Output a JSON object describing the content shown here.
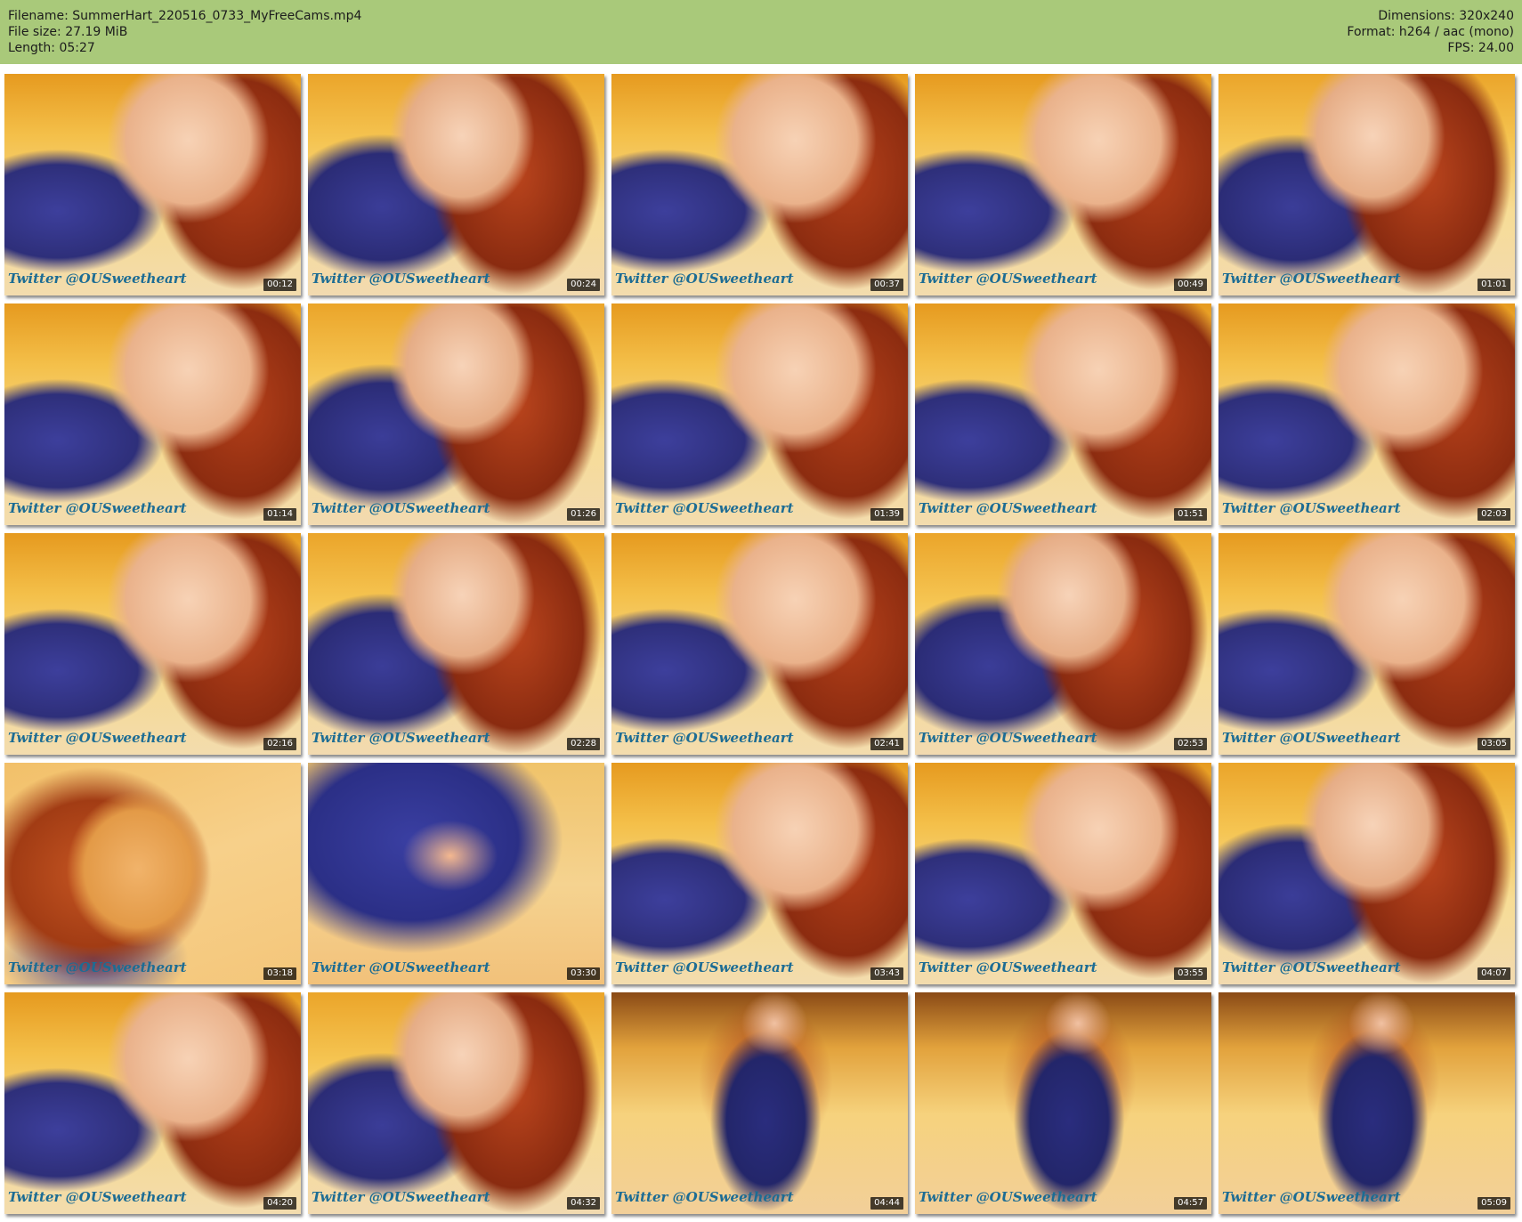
{
  "header": {
    "left": [
      "Filename: SummerHart_220516_0733_MyFreeCams.mp4",
      "File size: 27.19 MiB",
      "Length: 05:27"
    ],
    "right": [
      "Dimensions: 320x240",
      "Format: h264 / aac (mono)",
      "FPS: 24.00"
    ]
  },
  "colors": {
    "header_bg": "#a9c97a",
    "watermark": "#1c6c94"
  },
  "thumbnails": [
    {
      "time": "00:12",
      "watermark": "Twitter @OUSweetheart"
    },
    {
      "time": "00:24",
      "watermark": "Twitter @OUSweetheart"
    },
    {
      "time": "00:37",
      "watermark": "Twitter @OUSweetheart"
    },
    {
      "time": "00:49",
      "watermark": "Twitter @OUSweetheart"
    },
    {
      "time": "01:01",
      "watermark": "Twitter @OUSweetheart"
    },
    {
      "time": "01:14",
      "watermark": "Twitter @OUSweetheart"
    },
    {
      "time": "01:26",
      "watermark": "Twitter @OUSweetheart"
    },
    {
      "time": "01:39",
      "watermark": "Twitter @OUSweetheart"
    },
    {
      "time": "01:51",
      "watermark": "Twitter @OUSweetheart"
    },
    {
      "time": "02:03",
      "watermark": "Twitter @OUSweetheart"
    },
    {
      "time": "02:16",
      "watermark": "Twitter @OUSweetheart"
    },
    {
      "time": "02:28",
      "watermark": "Twitter @OUSweetheart"
    },
    {
      "time": "02:41",
      "watermark": "Twitter @OUSweetheart"
    },
    {
      "time": "02:53",
      "watermark": "Twitter @OUSweetheart"
    },
    {
      "time": "03:05",
      "watermark": "Twitter @OUSweetheart"
    },
    {
      "time": "03:18",
      "watermark": "Twitter @OUSweetheart"
    },
    {
      "time": "03:30",
      "watermark": "Twitter @OUSweetheart"
    },
    {
      "time": "03:43",
      "watermark": "Twitter @OUSweetheart"
    },
    {
      "time": "03:55",
      "watermark": "Twitter @OUSweetheart"
    },
    {
      "time": "04:07",
      "watermark": "Twitter @OUSweetheart"
    },
    {
      "time": "04:20",
      "watermark": "Twitter @OUSweetheart"
    },
    {
      "time": "04:32",
      "watermark": "Twitter @OUSweetheart"
    },
    {
      "time": "04:44",
      "watermark": "Twitter @OUSweetheart"
    },
    {
      "time": "04:57",
      "watermark": "Twitter @OUSweetheart"
    },
    {
      "time": "05:09",
      "watermark": "Twitter @OUSweetheart"
    }
  ]
}
